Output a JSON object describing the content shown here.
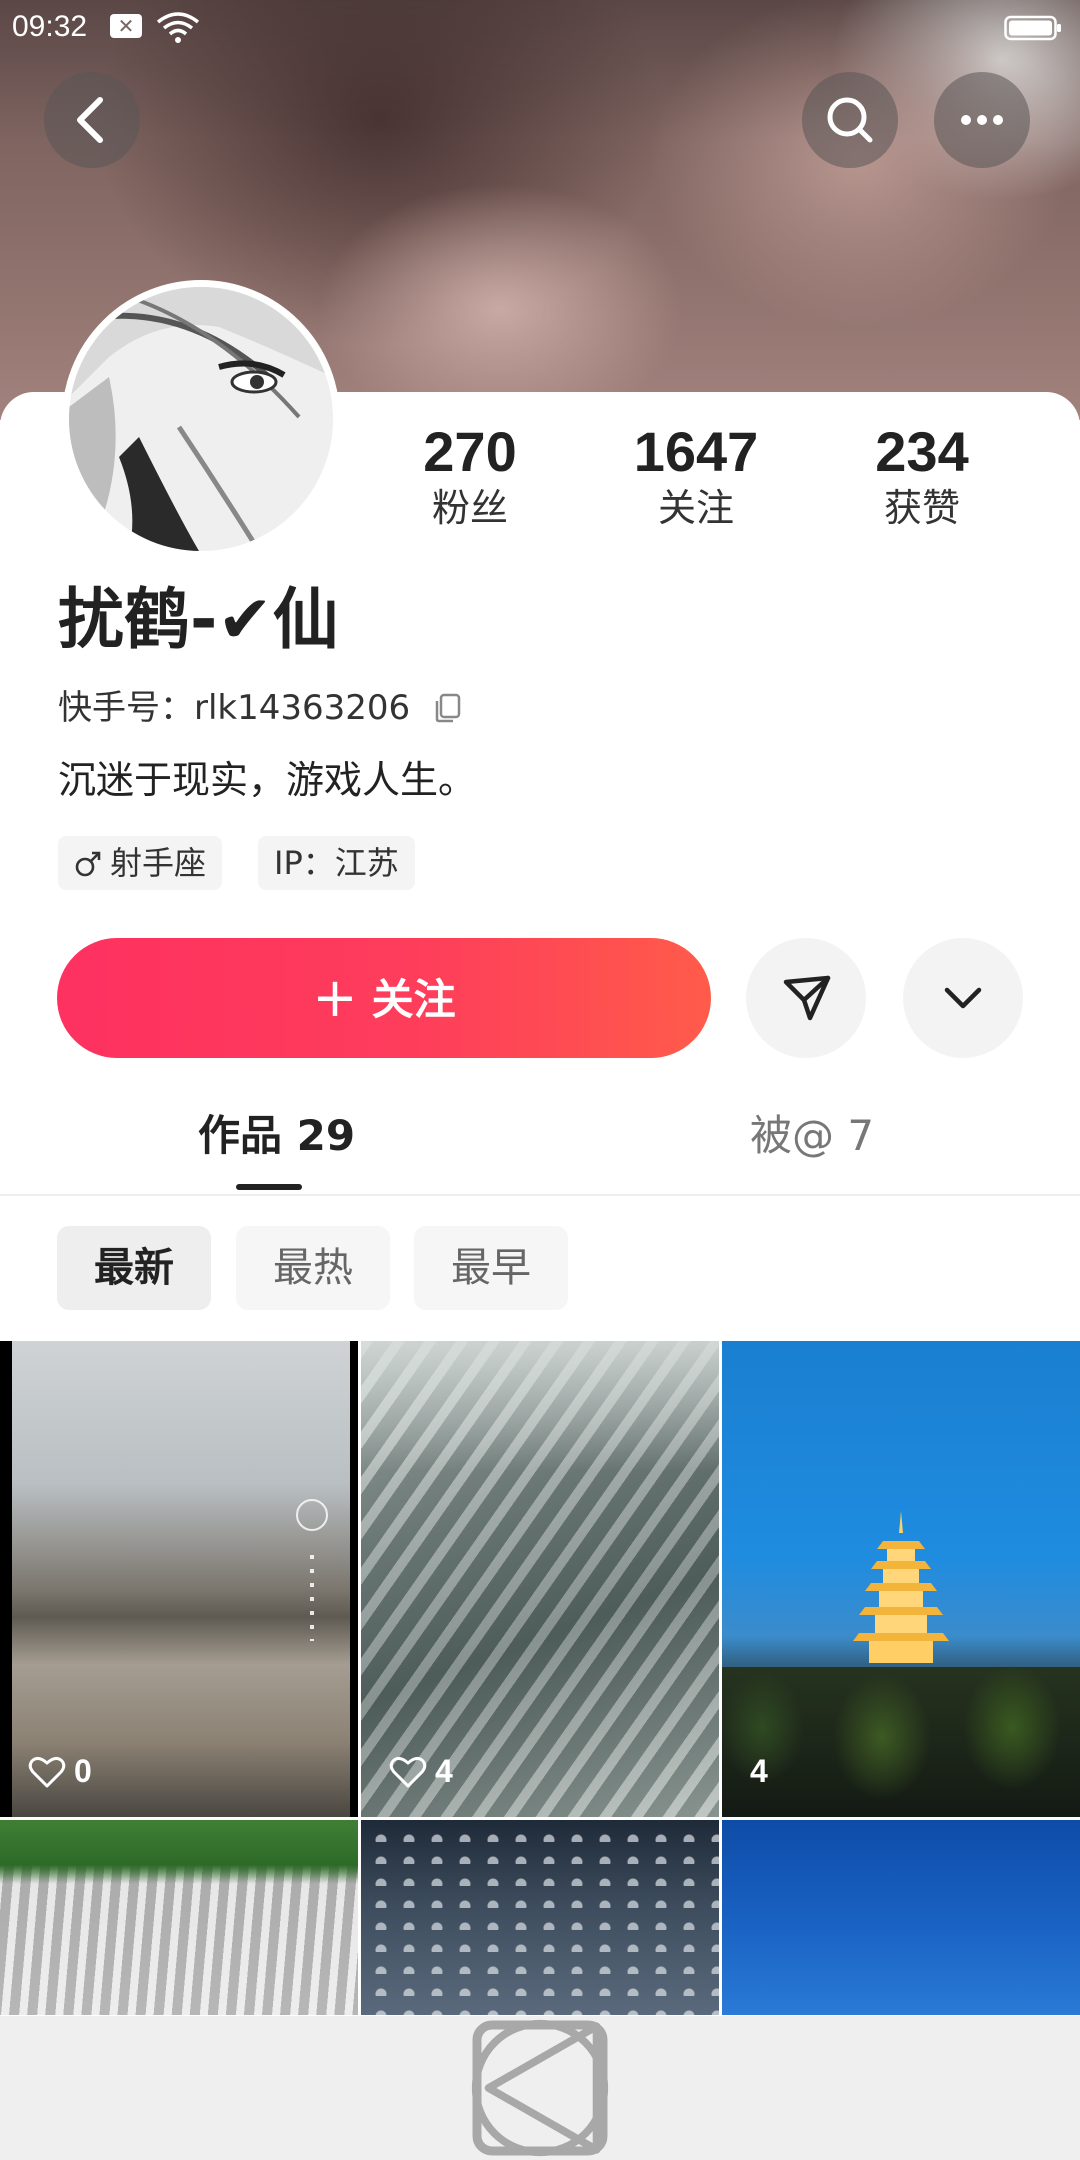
{
  "status_bar": {
    "time": "09:32",
    "notification_glyph": "✕"
  },
  "header": {
    "icons": {
      "back": "back-arrow-icon",
      "search": "search-icon",
      "more": "more-dots-icon"
    }
  },
  "profile": {
    "stats": [
      {
        "value": "270",
        "label": "粉丝"
      },
      {
        "value": "1647",
        "label": "关注"
      },
      {
        "value": "234",
        "label": "获赞"
      }
    ],
    "username": "扰鹤-✔仙",
    "kuaishou_id_label": "快手号：",
    "kuaishou_id": "rlk14363206",
    "bio": "沉迷于现实，游戏人生。",
    "tags": {
      "zodiac": "射手座",
      "ip": "IP：江苏"
    }
  },
  "actions": {
    "follow_plus": "+",
    "follow_label": "关注",
    "accent_gradient": [
      "#fe3160",
      "#ff5b4a"
    ]
  },
  "tabs": [
    {
      "label": "作品 29",
      "active": true
    },
    {
      "label": "被@ 7",
      "active": false
    }
  ],
  "sort_chips": [
    {
      "label": "最新",
      "active": true
    },
    {
      "label": "最热",
      "active": false
    },
    {
      "label": "最早",
      "active": false
    }
  ],
  "grid": [
    {
      "likes": "0"
    },
    {
      "likes": "4"
    },
    {
      "likes": "4"
    },
    {
      "likes": ""
    },
    {
      "likes": ""
    },
    {
      "likes": ""
    }
  ]
}
